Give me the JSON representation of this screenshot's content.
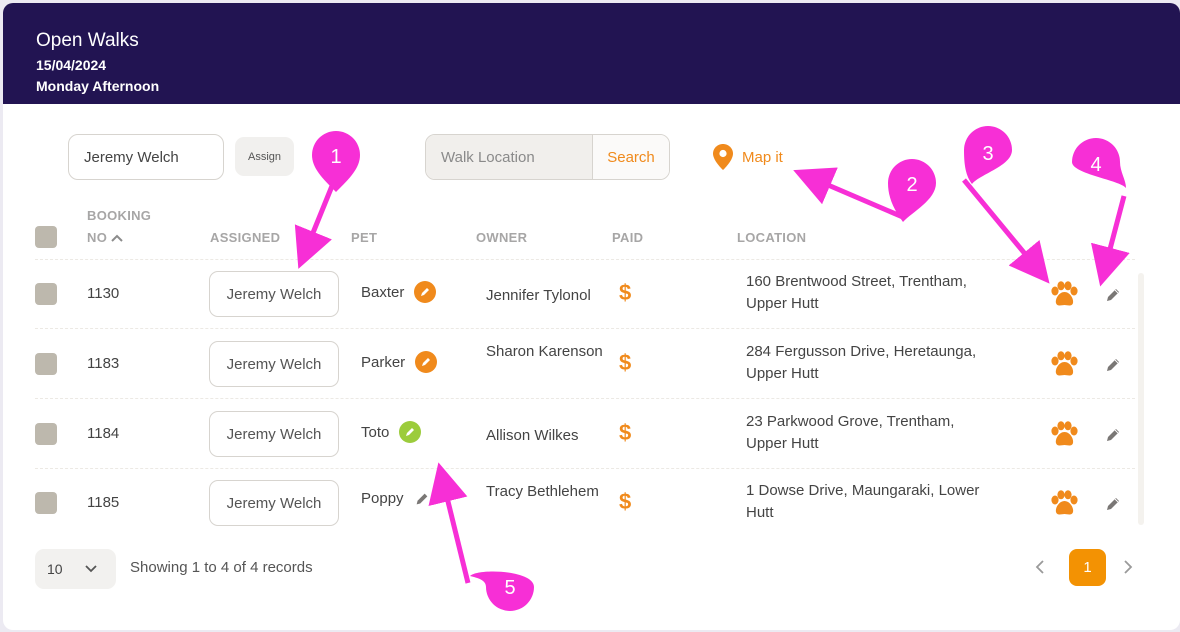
{
  "header": {
    "title": "Open Walks",
    "date": "15/04/2024",
    "period": "Monday Afternoon"
  },
  "toolbar": {
    "walker_value": "Jeremy Welch",
    "assign_label": "Assign",
    "location_placeholder": "Walk Location",
    "search_label": "Search",
    "map_label": "Map it"
  },
  "table": {
    "headers": {
      "booking_line1": "BOOKING",
      "booking_line2": "NO",
      "assigned": "ASSIGNED",
      "pet": "PET",
      "owner": "OWNER",
      "paid": "PAID",
      "location": "LOCATION"
    },
    "rows": [
      {
        "booking": "1130",
        "assigned": "Jeremy Welch",
        "pet": "Baxter",
        "owner": "Jennifer Tylonol",
        "paid": "$",
        "location": "160 Brentwood Street, Trentham, Upper Hutt"
      },
      {
        "booking": "1183",
        "assigned": "Jeremy Welch",
        "pet": "Parker",
        "owner": "Sharon Karenson",
        "paid": "$",
        "location": "284 Fergusson Drive, Heretaunga, Upper Hutt"
      },
      {
        "booking": "1184",
        "assigned": "Jeremy Welch",
        "pet": "Toto",
        "owner": "Allison Wilkes",
        "paid": "$",
        "location": "23 Parkwood Grove, Trentham, Upper Hutt"
      },
      {
        "booking": "1185",
        "assigned": "Jeremy Welch",
        "pet": "Poppy",
        "owner": "Tracy Bethlehem",
        "paid": "$",
        "location": "1 Dowse Drive, Maungaraki, Lower Hutt"
      }
    ],
    "pet_badges": [
      "orange",
      "orange",
      "green",
      "none"
    ]
  },
  "footer": {
    "page_size": "10",
    "records_text": "Showing 1 to 4 of 4 records",
    "current_page": "1"
  },
  "annotations": {
    "labels": [
      "1",
      "2",
      "3",
      "4",
      "5"
    ]
  },
  "colors": {
    "header_bg": "#221452",
    "accent": "#f08a1c",
    "page_active": "#f39203",
    "annotation": "#f72fd6",
    "badge_orange": "#f08a1c",
    "badge_green": "#9ccc3c"
  },
  "icons": {
    "map": "map-pin-icon",
    "sort": "sort-ascending-icon",
    "paw": "paw-icon",
    "edit": "pencil-icon",
    "page_size": "chevron-down-icon",
    "prev": "chevron-left-icon",
    "next": "chevron-right-icon"
  }
}
